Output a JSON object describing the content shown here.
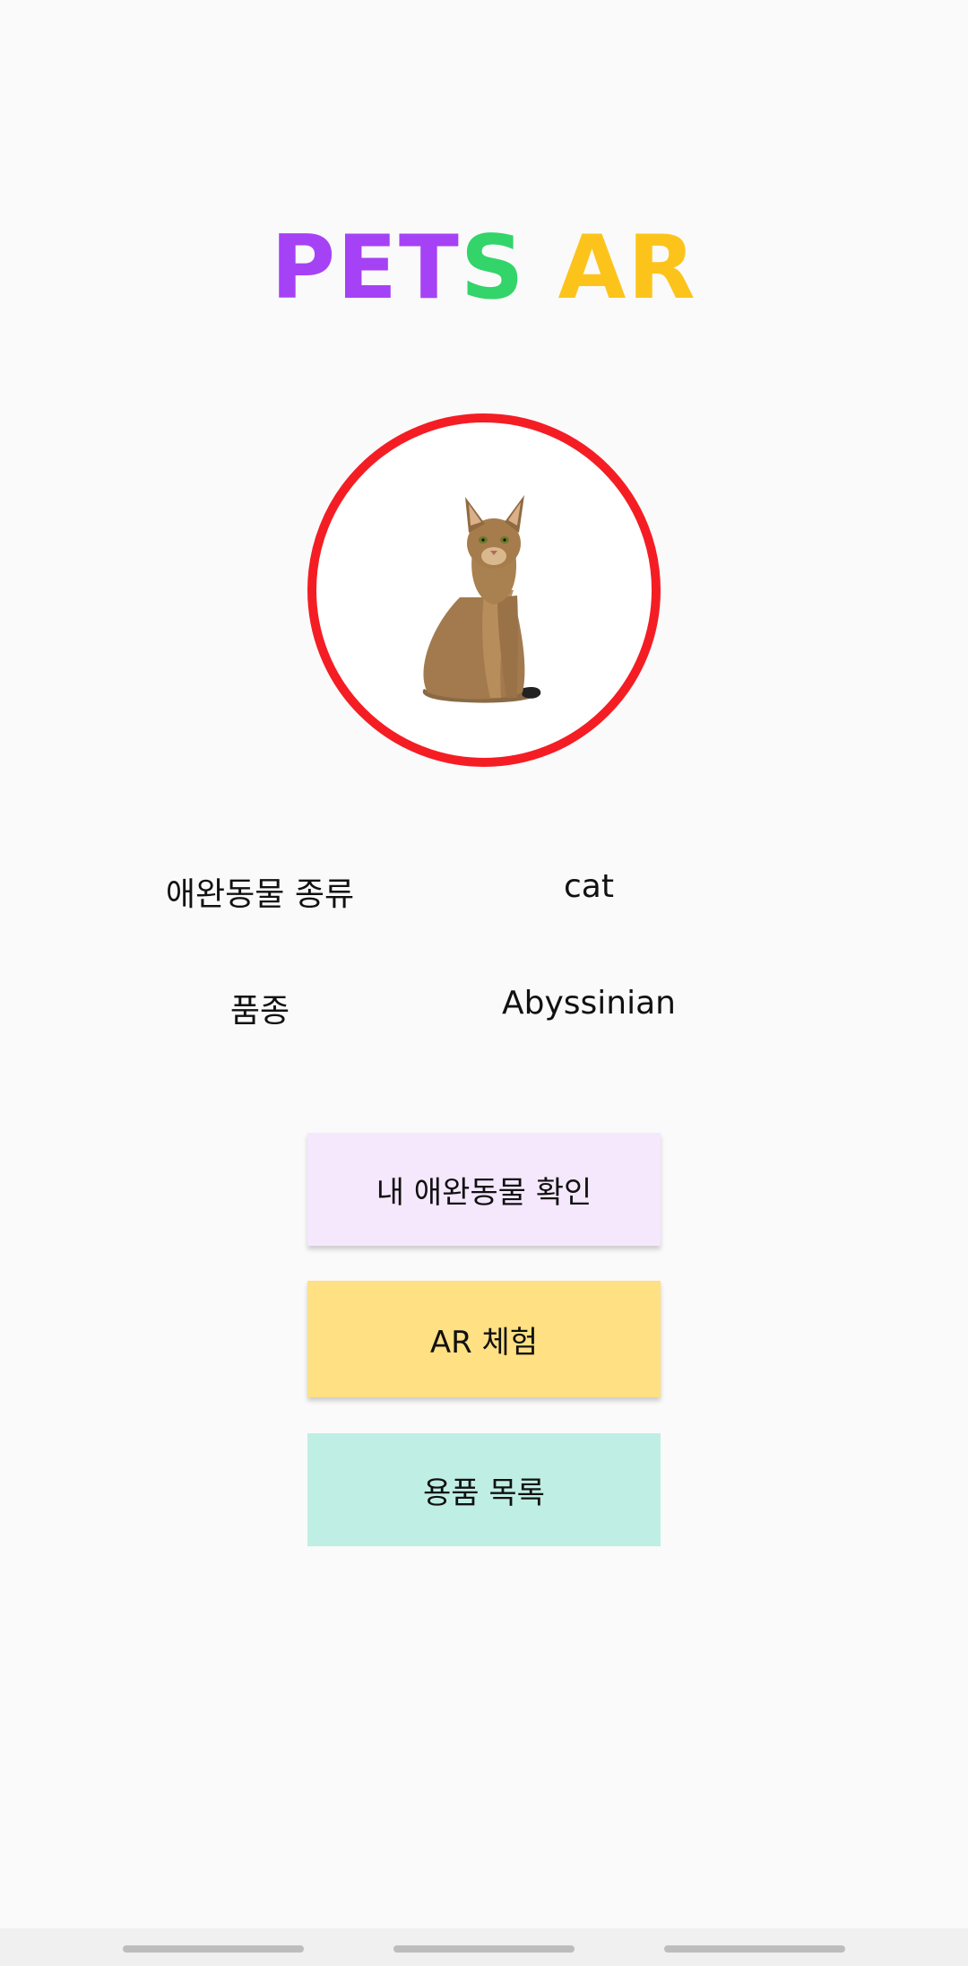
{
  "logo": {
    "part1": "PET",
    "part2": "S",
    "part3": "AR",
    "colors": {
      "pet": "#a642f5",
      "s": "#33d46a",
      "ar": "#fcc41b"
    }
  },
  "photo": {
    "ring_color": "#f51d24",
    "subject": "cat-image"
  },
  "info": {
    "type_label": "애완동물 종류",
    "type_value": "cat",
    "breed_label": "품종",
    "breed_value": "Abyssinian"
  },
  "buttons": {
    "check_label": "내 애완동물 확인",
    "ar_label": "AR 체험",
    "goods_label": "용품 목록"
  }
}
